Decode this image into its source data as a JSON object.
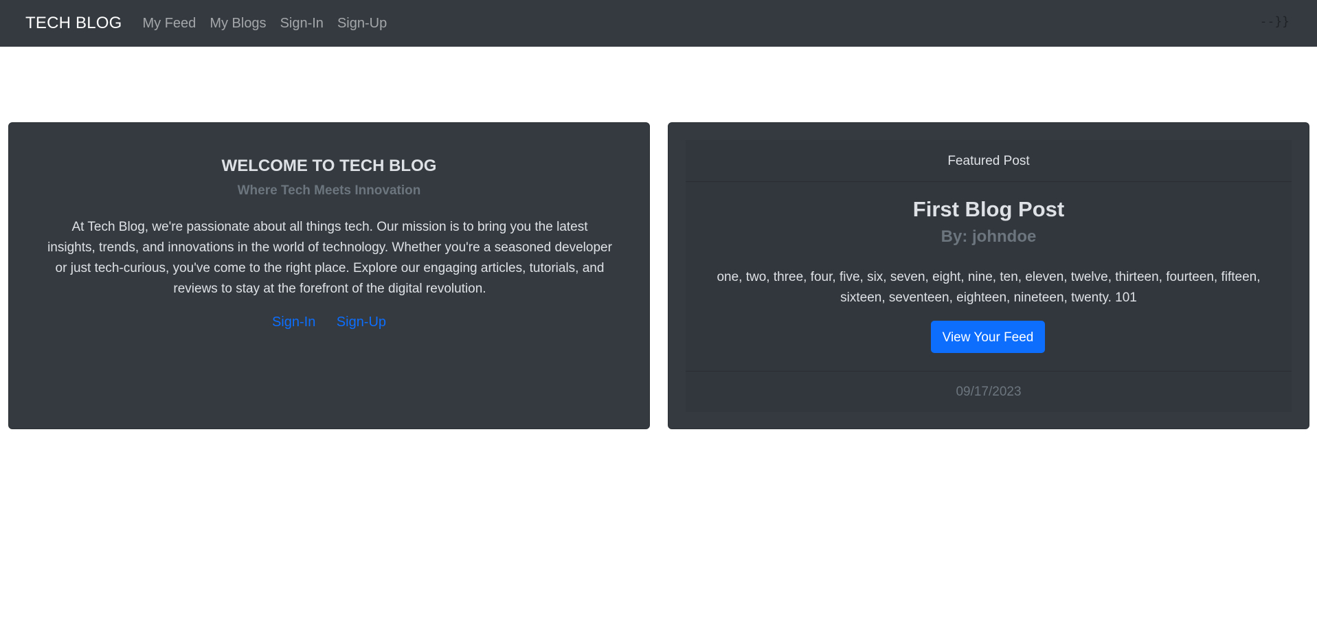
{
  "navbar": {
    "brand": "TECH BLOG",
    "links": [
      "My Feed",
      "My Blogs",
      "Sign-In",
      "Sign-Up"
    ],
    "right_text": "--}}"
  },
  "welcome": {
    "title": "WELCOME TO TECH BLOG",
    "subtitle": "Where Tech Meets Innovation",
    "body": "At Tech Blog, we're passionate about all things tech. Our mission is to bring you the latest insights, trends, and innovations in the world of technology. Whether you're a seasoned developer or just tech-curious, you've come to the right place. Explore our engaging articles, tutorials, and reviews to stay at the forefront of the digital revolution.",
    "signin_label": "Sign-In",
    "signup_label": "Sign-Up"
  },
  "featured": {
    "header": "Featured Post",
    "post_title": "First Blog Post",
    "author": "By: johndoe",
    "body": "one, two, three, four, five, six, seven, eight, nine, ten, eleven, twelve, thirteen, fourteen, fifteen, sixteen, seventeen, eighteen, nineteen, twenty. 101",
    "button_label": "View Your Feed",
    "date": "09/17/2023"
  },
  "colors": {
    "navbar_bg": "#343a40",
    "card_bg": "#343a40",
    "link_blue": "#0d6efd",
    "muted": "#6c757d",
    "text_light": "#dee2e6"
  }
}
